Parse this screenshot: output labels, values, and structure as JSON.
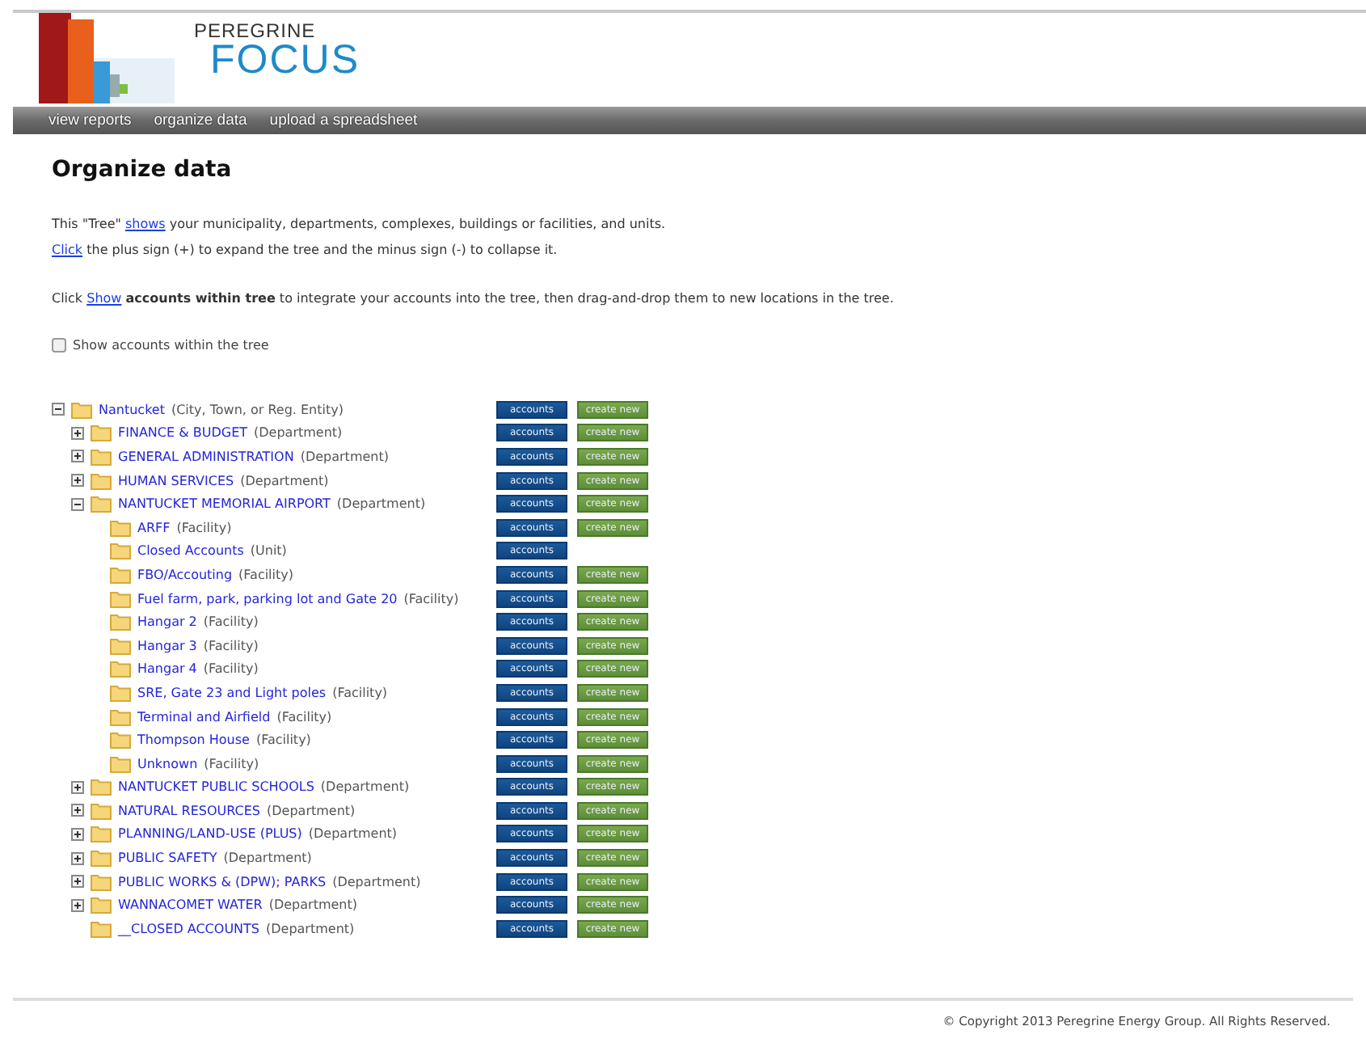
{
  "logo": {
    "top": "PEREGRINE",
    "bottom": "FOCUS"
  },
  "nav": [
    {
      "label": "view reports"
    },
    {
      "label": "organize data"
    },
    {
      "label": "upload a spreadsheet"
    }
  ],
  "title": "Organize data",
  "intro": [
    {
      "before": "This \"Tree\" ",
      "link": "shows",
      "after": " your municipality, departments, complexes, buildings or facilities, and units."
    },
    {
      "link": "Click",
      "after": " the plus sign (+) to expand the tree and the minus sign (-) to collapse it."
    },
    {
      "before": "Click ",
      "link": "Show",
      "after": " **accounts within tree** to integrate your accounts into the tree, then drag-and-drop them to new locations in the tree."
    }
  ],
  "show_accounts": {
    "label": "Show accounts within the tree",
    "checked": false
  },
  "tree": [
    {
      "name": "Nantucket",
      "type": "(City, Town, or Reg. Entity)",
      "kind": "branch",
      "expanded": true,
      "buttons": [
        "accounts",
        "create new"
      ],
      "children": [
        {
          "name": "FINANCE & BUDGET",
          "type": "(Department)",
          "kind": "branch",
          "expanded": false,
          "buttons": [
            "accounts",
            "create new"
          ]
        },
        {
          "name": "GENERAL ADMINISTRATION",
          "type": "(Department)",
          "kind": "branch",
          "expanded": false,
          "buttons": [
            "accounts",
            "create new"
          ]
        },
        {
          "name": "HUMAN SERVICES",
          "type": "(Department)",
          "kind": "branch",
          "expanded": false,
          "buttons": [
            "accounts",
            "create new"
          ]
        },
        {
          "name": "NANTUCKET MEMORIAL AIRPORT",
          "type": "(Department)",
          "kind": "branch",
          "expanded": true,
          "buttons": [
            "accounts",
            "create new"
          ],
          "children": [
            {
              "name": "ARFF",
              "type": "(Facility)",
              "kind": "leaf",
              "buttons": [
                "accounts",
                "create new"
              ]
            },
            {
              "name": "Closed Accounts",
              "type": "(Unit)",
              "kind": "leaf",
              "buttons": [
                "accounts"
              ]
            },
            {
              "name": "FBO/Accouting",
              "type": "(Facility)",
              "kind": "leaf",
              "buttons": [
                "accounts",
                "create new"
              ]
            },
            {
              "name": "Fuel farm, park, parking lot and Gate 20",
              "type": "(Facility)",
              "kind": "leaf",
              "buttons": [
                "accounts",
                "create new"
              ]
            },
            {
              "name": "Hangar 2",
              "type": "(Facility)",
              "kind": "leaf",
              "buttons": [
                "accounts",
                "create new"
              ]
            },
            {
              "name": "Hangar 3",
              "type": "(Facility)",
              "kind": "leaf",
              "buttons": [
                "accounts",
                "create new"
              ]
            },
            {
              "name": "Hangar 4",
              "type": "(Facility)",
              "kind": "leaf",
              "buttons": [
                "accounts",
                "create new"
              ]
            },
            {
              "name": "SRE, Gate 23 and Light poles",
              "type": "(Facility)",
              "kind": "leaf",
              "buttons": [
                "accounts",
                "create new"
              ]
            },
            {
              "name": "Terminal and Airfield",
              "type": "(Facility)",
              "kind": "leaf",
              "buttons": [
                "accounts",
                "create new"
              ]
            },
            {
              "name": "Thompson House",
              "type": "(Facility)",
              "kind": "leaf",
              "buttons": [
                "accounts",
                "create new"
              ]
            },
            {
              "name": "Unknown",
              "type": "(Facility)",
              "kind": "leaf",
              "buttons": [
                "accounts",
                "create new"
              ]
            }
          ]
        },
        {
          "name": "NANTUCKET PUBLIC SCHOOLS",
          "type": "(Department)",
          "kind": "branch",
          "expanded": false,
          "buttons": [
            "accounts",
            "create new"
          ]
        },
        {
          "name": "NATURAL RESOURCES",
          "type": "(Department)",
          "kind": "branch",
          "expanded": false,
          "buttons": [
            "accounts",
            "create new"
          ]
        },
        {
          "name": "PLANNING/LAND-USE (PLUS)",
          "type": "(Department)",
          "kind": "branch",
          "expanded": false,
          "buttons": [
            "accounts",
            "create new"
          ]
        },
        {
          "name": "PUBLIC SAFETY",
          "type": "(Department)",
          "kind": "branch",
          "expanded": false,
          "buttons": [
            "accounts",
            "create new"
          ]
        },
        {
          "name": "PUBLIC WORKS & (DPW); PARKS",
          "type": "(Department)",
          "kind": "branch",
          "expanded": false,
          "buttons": [
            "accounts",
            "create new"
          ]
        },
        {
          "name": "WANNACOMET WATER",
          "type": "(Department)",
          "kind": "branch",
          "expanded": false,
          "buttons": [
            "accounts",
            "create new"
          ]
        },
        {
          "name": "__CLOSED ACCOUNTS",
          "type": "(Department)",
          "kind": "leaf",
          "buttons": [
            "accounts",
            "create new"
          ]
        }
      ]
    }
  ],
  "footer": "© Copyright 2013 Peregrine Energy Group. All Rights Reserved."
}
